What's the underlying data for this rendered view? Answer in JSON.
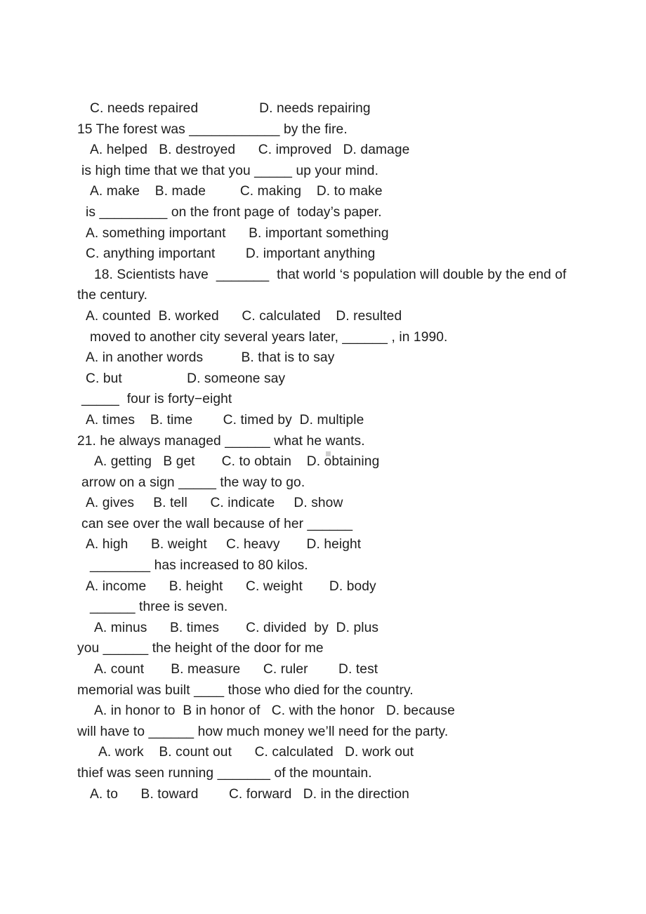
{
  "document": {
    "type": "grammar-multiple-choice-exercise",
    "background_color": "#ffffff",
    "text_color": "#1c1c1c",
    "lines": [
      {
        "id": "l01",
        "indent": 3,
        "text": "C. needs repaired                D. needs repairing"
      },
      {
        "id": "l02",
        "indent": 0,
        "text": "15 The forest was ____________ by the fire."
      },
      {
        "id": "l03",
        "indent": 3,
        "text": "A. helped   B. destroyed      C. improved   D. damage"
      },
      {
        "id": "l04",
        "indent": 1,
        "text": "is high time that we that you _____ up your mind."
      },
      {
        "id": "l05",
        "indent": 3,
        "text": "A. make    B. made         C. making    D. to make"
      },
      {
        "id": "l06",
        "indent": 2,
        "text": "is _________ on the front page of  today’s paper."
      },
      {
        "id": "l07",
        "indent": 2,
        "text": "A. something important      B. important something"
      },
      {
        "id": "l08",
        "indent": 2,
        "text": "C. anything important        D. important anything"
      },
      {
        "id": "l09",
        "indent": 4,
        "text": "18. Scientists have  _______  that world ‘s population will double by the end of"
      },
      {
        "id": "l10",
        "indent": 0,
        "text": "the century."
      },
      {
        "id": "l11",
        "indent": 2,
        "text": "A. counted  B. worked      C. calculated    D. resulted"
      },
      {
        "id": "l12",
        "indent": 3,
        "text": "moved to another city several years later, ______ , in 1990."
      },
      {
        "id": "l13",
        "indent": 2,
        "text": "A. in another words          B. that is to say"
      },
      {
        "id": "l14",
        "indent": 2,
        "text": "C. but                 D. someone say"
      },
      {
        "id": "l15",
        "indent": 1,
        "text": "_____  four is forty−eight"
      },
      {
        "id": "l16",
        "indent": 2,
        "text": "A. times    B. time        C. timed by  D. multiple"
      },
      {
        "id": "l17",
        "indent": 0,
        "text": "21. he always managed ______ what he wants."
      },
      {
        "id": "l18",
        "indent": 4,
        "text": "A. getting   B get       C. to obtain    D. obtaining"
      },
      {
        "id": "l19",
        "indent": 1,
        "text": "arrow on a sign _____ the way to go."
      },
      {
        "id": "l20",
        "indent": 2,
        "text": "A. gives     B. tell      C. indicate     D. show"
      },
      {
        "id": "l21",
        "indent": 1,
        "text": "can see over the wall because of her ______"
      },
      {
        "id": "l22",
        "indent": 2,
        "text": "A. high      B. weight     C. heavy       D. height"
      },
      {
        "id": "l23",
        "indent": 3,
        "text": "________ has increased to 80 kilos."
      },
      {
        "id": "l24",
        "indent": 2,
        "text": "A. income      B. height      C. weight       D. body"
      },
      {
        "id": "l25",
        "indent": 3,
        "text": "______ three is seven."
      },
      {
        "id": "l26",
        "indent": 4,
        "text": "A. minus      B. times       C. divided  by  D. plus"
      },
      {
        "id": "l27",
        "indent": 0,
        "text": "you ______ the height of the door for me"
      },
      {
        "id": "l28",
        "indent": 4,
        "text": "A. count       B. measure      C. ruler        D. test"
      },
      {
        "id": "l29",
        "indent": 0,
        "text": "memorial was built ____ those who died for the country."
      },
      {
        "id": "l30",
        "indent": 4,
        "text": "A. in honor to  B in honor of   C. with the honor   D. because"
      },
      {
        "id": "l31",
        "indent": 0,
        "text": "will have to ______ how much money we’ll need for the party."
      },
      {
        "id": "l32",
        "indent": 5,
        "text": "A. work    B. count out      C. calculated   D. work out"
      },
      {
        "id": "l33",
        "indent": 0,
        "text": "thief was seen running _______ of the mountain."
      },
      {
        "id": "l34",
        "indent": 3,
        "text": "A. to      B. toward        C. forward   D. in the direction"
      }
    ],
    "artifacts": [
      {
        "id": "scan-speck",
        "name": "scan-speck-artifact",
        "color": "#cfcfcf"
      }
    ]
  }
}
